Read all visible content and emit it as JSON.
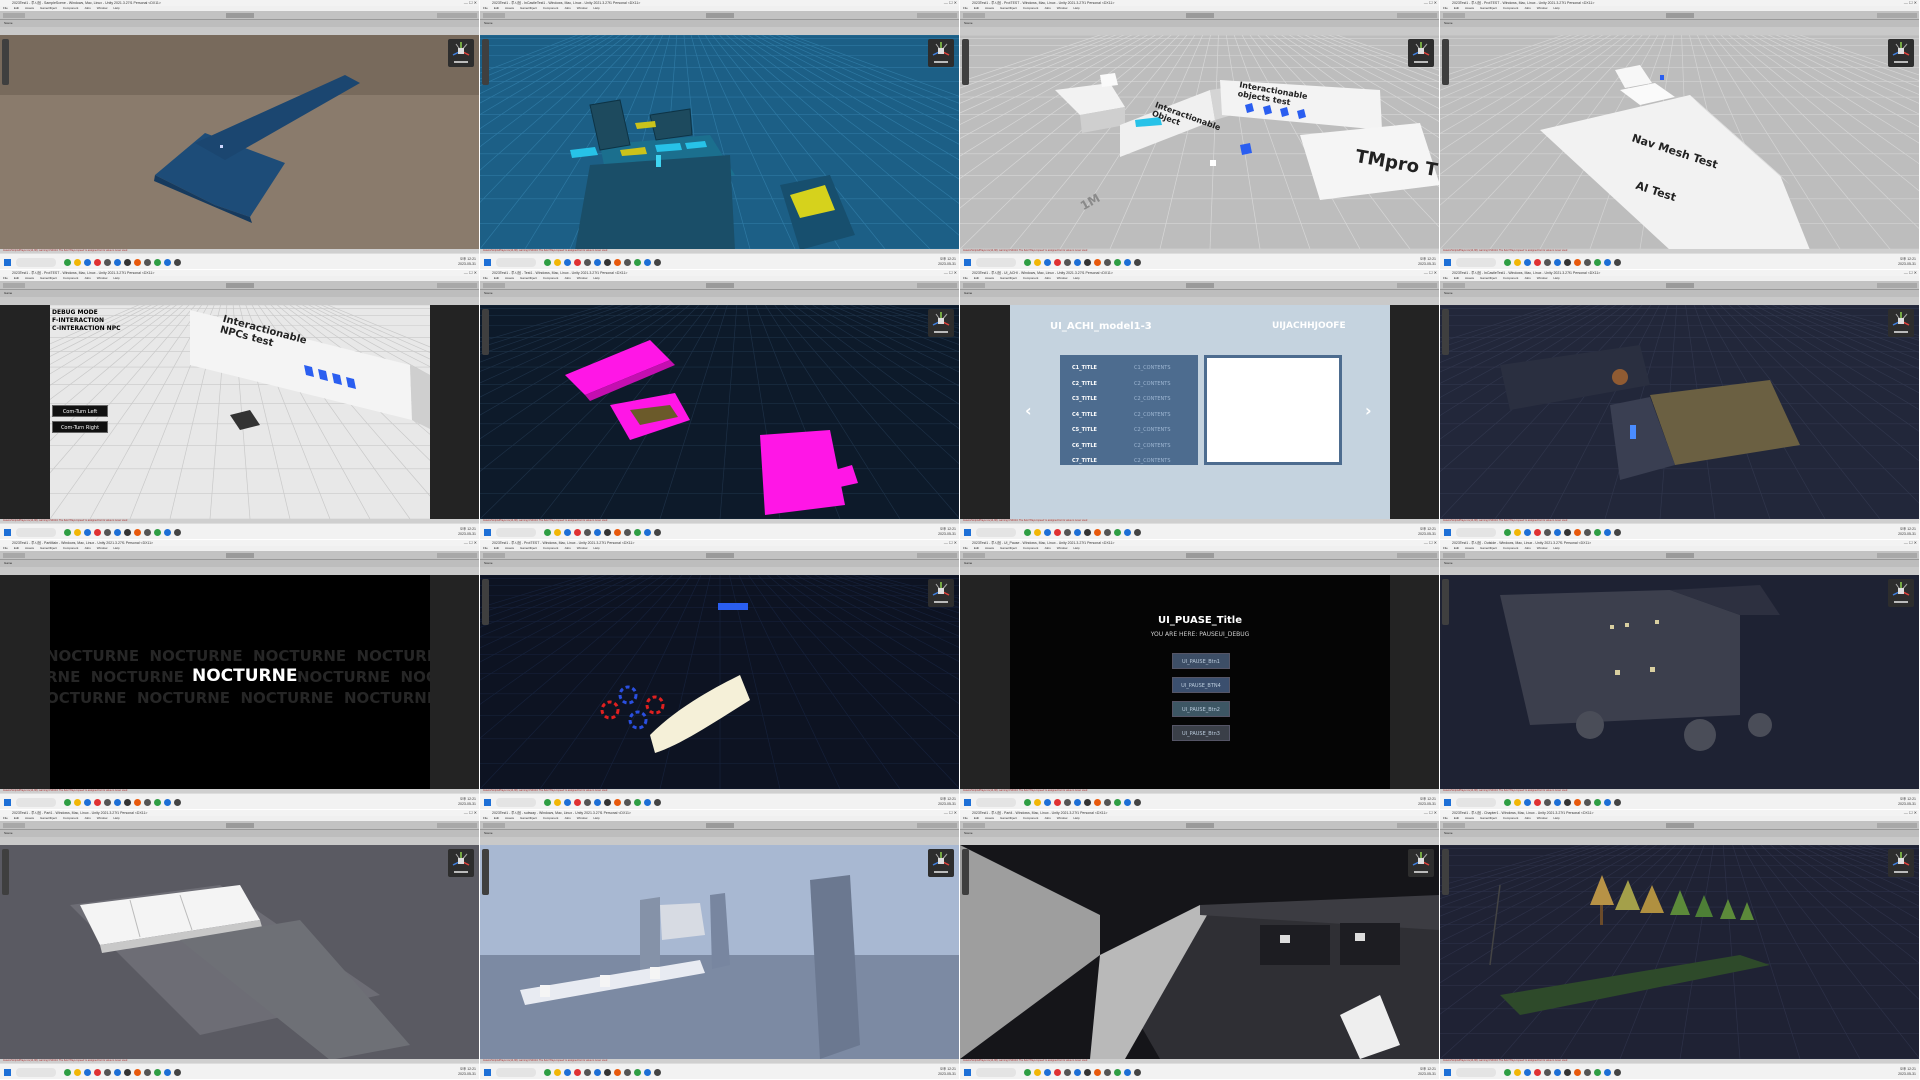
{
  "common": {
    "menu": [
      "File",
      "Edit",
      "Assets",
      "GameObject",
      "Component",
      "Jobs",
      "Window",
      "Help"
    ],
    "window_controls": "—  ☐  ✕"
  },
  "tiles": [
    {
      "title": "2023Test1 - 투시점 - SampleScene - Windows, Mac, Linux - Unity 2021.3.27f1 Personal <DX11>",
      "tab": "Scene",
      "scene": "scene-blue-platform",
      "kind": "scene"
    },
    {
      "title": "2023Test1 - 투시점 - InCastleTest1 - Windows, Mac, Linux - Unity 2021.3.27f1 Personal <DX11>",
      "tab": "Scene",
      "scene": "scene-blue-room",
      "kind": "scene"
    },
    {
      "title": "2023Test1 - 투시점 - ProtTEST - Windows, Mac, Linux - Unity 2021.3.27f1 Personal <DX11>",
      "tab": "Scene",
      "scene": "scene-interactable-test",
      "kind": "scene",
      "labels": {
        "tmpro": "TMpro T",
        "interactionable_object": "Interactionable Object",
        "interactionable_objects_test": "Interactionable objects test",
        "one_m": "1M"
      }
    },
    {
      "title": "2023Test1 - 투시점 - ProtTEST - Windows, Mac, Linux - Unity 2021.3.27f1 Personal <DX11>",
      "tab": "Scene",
      "scene": "scene-navmesh-test",
      "kind": "scene",
      "labels": {
        "navmesh": "Nav Mesh Test",
        "ai": "AI Test"
      }
    },
    {
      "title": "2023Test1 - 투시점 - ProtTEST - Windows, Mac, Linux - Unity 2021.3.27f1 Personal <DX11>",
      "tab": "Game",
      "scene": "game-npc-test",
      "kind": "game",
      "labels": {
        "debug_mode": "DEBUG MODE",
        "f_interaction": "F-INTERACTION",
        "c_interaction": "C-INTERACTION NPC",
        "npc_sign": "Interactionable NPCs test",
        "btn_left": "Com-Turn Left",
        "btn_right": "Com-Turn Right"
      }
    },
    {
      "title": "2023Test1 - 투시점 - Test1 - Windows, Mac, Linux - Unity 2021.3.27f1 Personal <DX11>",
      "tab": "Scene",
      "scene": "scene-magenta",
      "kind": "scene"
    },
    {
      "title": "2023Test1 - 투시점 - UI_ACHI - Windows, Mac, Linux - Unity 2021.3.27f1 Personal <DX11>",
      "tab": "Game",
      "scene": "game-achievements",
      "kind": "game",
      "achi": {
        "title": "UI_ACHI_model1-3",
        "logo": "UIJACHHJOOFE",
        "rows": [
          {
            "t": "C1_TITLE",
            "c": "C1_CONTENTS"
          },
          {
            "t": "C2_TITLE",
            "c": "C2_CONTENTS"
          },
          {
            "t": "C3_TITLE",
            "c": "C2_CONTENTS"
          },
          {
            "t": "C4_TITLE",
            "c": "C2_CONTENTS"
          },
          {
            "t": "C5_TITLE",
            "c": "C2_CONTENTS"
          },
          {
            "t": "C6_TITLE",
            "c": "C2_CONTENTS"
          },
          {
            "t": "C7_TITLE",
            "c": "C2_CONTENTS"
          }
        ],
        "prev": "‹",
        "next": "›"
      }
    },
    {
      "title": "2023Test1 - 투시점 - InCastleTest1 - Windows, Mac, Linux - Unity 2021.3.27f1 Personal <DX11>",
      "tab": "Scene",
      "scene": "scene-dark-room",
      "kind": "scene"
    },
    {
      "title": "2023Test1 - 투시점 - PartMain - Windows, Mac, Linux - Unity 2021.3.27f1 Personal <DX11>",
      "tab": "Game",
      "scene": "game-nocturne",
      "kind": "game",
      "nocturne": {
        "main": "NOCTURNE",
        "row1": "NOCTURNE  NOCTURNE  NOCTURNE  NOCTURNE  NOCTURNE",
        "row2": "RNE  NOCTURNE",
        "row2b": "NOCTURNE  NOC",
        "row3": "OCTURNE  NOCTURNE  NOCTURNE  NOCTURNE  NOCTURNE"
      }
    },
    {
      "title": "2023Test1 - 투시점 - ProtTEST - Windows, Mac, Linux - Unity 2021.3.27f1 Personal <DX11>",
      "tab": "Scene",
      "scene": "scene-flashlight",
      "kind": "scene"
    },
    {
      "title": "2023Test1 - 투시점 - UI_Pause - Windows, Mac, Linux - Unity 2021.3.27f1 Personal <DX11>",
      "tab": "Game",
      "scene": "game-pause",
      "kind": "game",
      "pause": {
        "title": "UI_PUASE_Title",
        "sub": "YOU ARE HERE: PAUSEUI_DEBUG",
        "buttons": [
          "UI_PAUSE_Btn1",
          "UI_PAUSE_BTN4",
          "UI_PAUSE_Btn2",
          "UI_PAUSE_Btn3"
        ]
      }
    },
    {
      "title": "2023Test1 - 투시점 - Outside - Windows, Mac, Linux - Unity 2021.3.27f1 Personal <DX11>",
      "tab": "Scene",
      "scene": "scene-night-building",
      "kind": "scene"
    },
    {
      "title": "2023Test1 - 투시점 - Part1 - Windows, Mac, Linux - Unity 2021.3.27f1 Personal <DX11>",
      "tab": "Scene",
      "scene": "scene-white-rooms",
      "kind": "scene"
    },
    {
      "title": "2023Test1 - 투시점 - subway - Windows, Mac, Linux - Unity 2021.3.27f1 Personal <DX11>",
      "tab": "Scene",
      "scene": "scene-subway-blocks",
      "kind": "scene"
    },
    {
      "title": "2023Test1 - 투시점 - Part4 - Windows, Mac, Linux - Unity 2021.3.27f1 Personal <DX11>",
      "tab": "Scene",
      "scene": "scene-train-station",
      "kind": "scene"
    },
    {
      "title": "2023Test1 - 투시점 - Chapter1 - Windows, Mac, Linux - Unity 2021.3.27f1 Personal <DX11>",
      "tab": "Scene",
      "scene": "scene-night-trees",
      "kind": "scene"
    }
  ],
  "taskbar": {
    "time": "오후 12:21",
    "date": "2023-05-31"
  },
  "console_msg": "Assets/Scripts/Player.cs(14,38): warning CS0414: The field 'Player.speed' is assigned but its value is never used"
}
